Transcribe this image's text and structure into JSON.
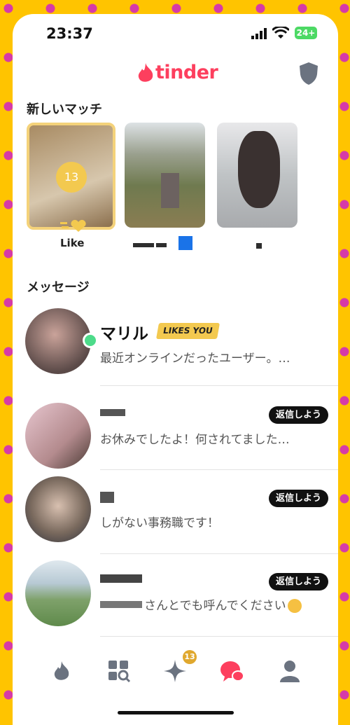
{
  "status_bar": {
    "time": "23:37",
    "battery": "24+"
  },
  "header": {
    "logo_text": "tinder"
  },
  "new_matches": {
    "title": "新しいマッチ",
    "like_card": {
      "count": "13",
      "label": "Like"
    }
  },
  "messages": {
    "title": "メッセージ",
    "items": [
      {
        "name": "マリル",
        "badge": "LIKES YOU",
        "preview": "最近オンラインだったユーザー。…"
      },
      {
        "reply_label": "返信しよう",
        "preview": "お休みでしたよ！何されてました…"
      },
      {
        "reply_label": "返信しよう",
        "preview": "しがない事務職です！"
      },
      {
        "reply_label": "返信しよう",
        "preview": "さんとでも呼んでください"
      }
    ]
  },
  "tabbar": {
    "spark_badge": "13"
  },
  "colors": {
    "brand": "#fd3f5e",
    "gold": "#f3c94f",
    "online": "#4ddb8a"
  }
}
